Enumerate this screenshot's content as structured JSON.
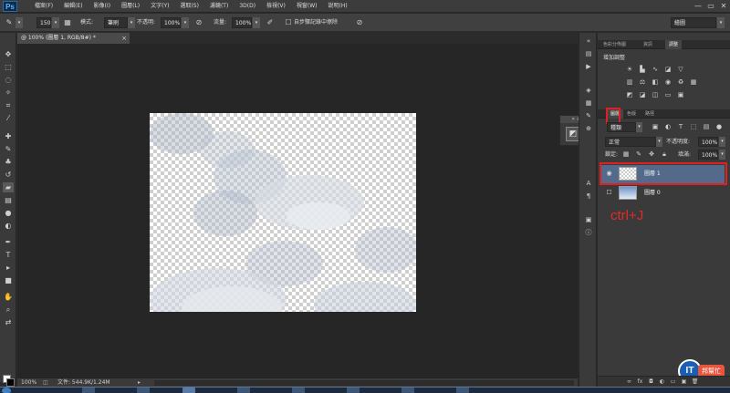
{
  "menubar": {
    "logo": "Ps",
    "items": [
      "檔案(F)",
      "編輯(E)",
      "影像(I)",
      "圖層(L)",
      "文字(Y)",
      "選取(S)",
      "濾鏡(T)",
      "3D(D)",
      "檢視(V)",
      "視窗(W)",
      "說明(H)"
    ],
    "window_controls": [
      "—",
      "▭",
      "✕"
    ]
  },
  "options": {
    "brush_size": "150",
    "mode_label": "模式:",
    "mode_value": "筆刷",
    "opacity_label": "不透明:",
    "opacity_value": "100%",
    "flow_label": "流量:",
    "flow_value": "100%",
    "history_label": "自步驟記錄中擦除",
    "workspace_value": "繪圖"
  },
  "document": {
    "tab_label": "@ 100% (圖層 1, RGB/8#) *",
    "tab_close": "×"
  },
  "status": {
    "zoom": "100%",
    "file_info": "文件: 544.9K/1.24M"
  },
  "panels": {
    "top_tabs": [
      "色彩分佈圖",
      "資訊",
      "調整"
    ],
    "top_active": "調整",
    "adjust_title": "增加調整",
    "layers_tabs": [
      "圖層",
      "色版",
      "路徑"
    ],
    "layers_active": "圖層",
    "kind_value": "種類",
    "blend_value": "正常",
    "opacity_label": "不透明度:",
    "opacity_value": "100%",
    "lock_label": "鎖定:",
    "fill_label": "填滿:",
    "fill_value": "100%",
    "layers": [
      {
        "name": "圖層 1",
        "selected": true
      },
      {
        "name": "圖層 0",
        "selected": false
      }
    ]
  },
  "annotation": "ctrl+J",
  "watermark": {
    "logo": "IT",
    "text": "邦幫忙"
  },
  "colors": {
    "highlight": "#e02020",
    "selected_layer": "#536a8a",
    "app_bg": "#2b2b2b",
    "workspace": "#262626"
  }
}
